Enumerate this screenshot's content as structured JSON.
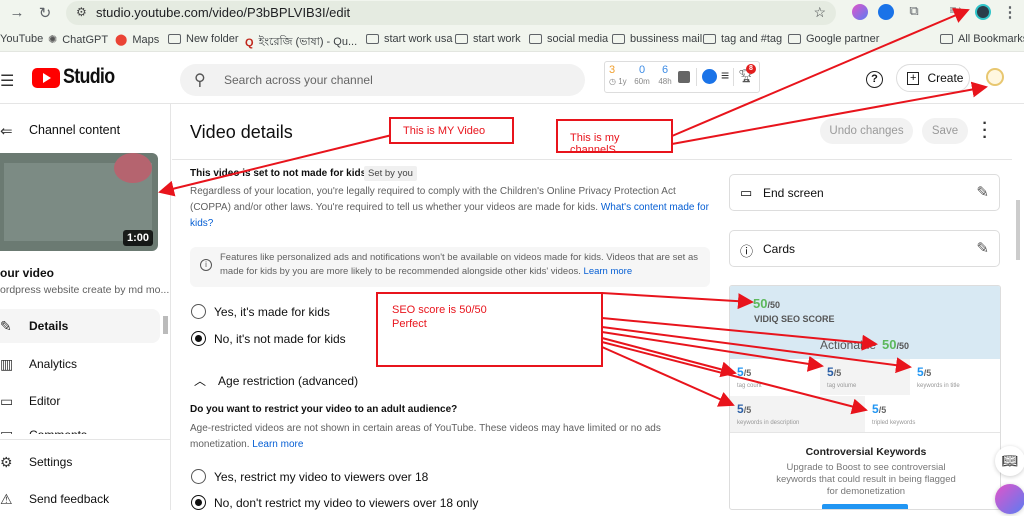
{
  "browser": {
    "url": "studio.youtube.com/video/P3bBPLVIB3I/edit",
    "bookmarks": [
      {
        "label": "YouTube",
        "icon": "youtube"
      },
      {
        "label": "ChatGPT",
        "icon": "chatgpt-icon"
      },
      {
        "label": "Maps",
        "icon": "maps-pin-icon"
      },
      {
        "label": "New folder",
        "icon": "folder-icon"
      },
      {
        "label": "ইংরেজি (ভাষা) - Qu...",
        "icon": "quora-icon"
      },
      {
        "label": "start work usa",
        "icon": "folder-icon"
      },
      {
        "label": "start work",
        "icon": "folder-icon"
      },
      {
        "label": "social media",
        "icon": "folder-icon"
      },
      {
        "label": "bussiness mail",
        "icon": "folder-icon"
      },
      {
        "label": "tag and #tag",
        "icon": "folder-icon"
      },
      {
        "label": "Google partner",
        "icon": "folder-icon"
      }
    ],
    "all_bookmarks": "All Bookmarks"
  },
  "header": {
    "logo_text": "Studio",
    "search_placeholder": "Search across your channel",
    "vidiq_stats": [
      {
        "value": "3",
        "label": "1y",
        "color": "#f0a030"
      },
      {
        "value": "0",
        "label": "60m",
        "color": "#3d8ce6"
      },
      {
        "value": "6",
        "label": "48h",
        "color": "#3d8ce6"
      }
    ],
    "notification_count": "8",
    "create_label": "Create"
  },
  "sidebar": {
    "title": "Channel content",
    "video_duration": "1:00",
    "video_title": "our video",
    "video_desc": "ordpress website create by md mo...",
    "items": [
      {
        "label": "Details",
        "icon": "pencil-icon",
        "active": true
      },
      {
        "label": "Analytics",
        "icon": "analytics-icon"
      },
      {
        "label": "Editor",
        "icon": "editor-icon"
      },
      {
        "label": "Comments",
        "icon": "comments-icon"
      }
    ],
    "bottom": [
      {
        "label": "Settings",
        "icon": "gear-icon"
      },
      {
        "label": "Send feedback",
        "icon": "feedback-icon"
      }
    ]
  },
  "main": {
    "title": "Video details",
    "undo_label": "Undo changes",
    "save_label": "Save",
    "kids_status": "This video is set to not made for kids",
    "set_by": "Set by you",
    "coppa_text": "Regardless of your location, you're legally required to comply with the Children's Online Privacy Protection Act (COPPA) and/or other laws. You're required to tell us whether your videos are made for kids.",
    "coppa_link": "What's content made for kids?",
    "info_text": "Features like personalized ads and notifications won't be available on videos made for kids. Videos that are set as made for kids by you are more likely to be recommended alongside other kids' videos.",
    "info_link": "Learn more",
    "kids_options": [
      {
        "label": "Yes, it's made for kids",
        "selected": false
      },
      {
        "label": "No, it's not made for kids",
        "selected": true
      }
    ],
    "age_header": "Age restriction (advanced)",
    "age_question": "Do you want to restrict your video to an adult audience?",
    "age_text": "Age-restricted videos are not shown in certain areas of YouTube. These videos may have limited or no ads monetization.",
    "age_link": "Learn more",
    "age_options": [
      {
        "label": "Yes, restrict my video to viewers over 18",
        "selected": false
      },
      {
        "label": "No, don't restrict my video to viewers over 18 only",
        "selected": true
      }
    ]
  },
  "right_panel": {
    "end_screen": "End screen",
    "cards": "Cards",
    "seo": {
      "score": "50",
      "max": "/50",
      "label": "VIDIQ SEO SCORE",
      "actionable_label": "Actionable",
      "actionable_score": "50",
      "actionable_max": "/50",
      "metrics": [
        {
          "value": "5",
          "max": "/5",
          "label": "tag count",
          "color": "#2196f3"
        },
        {
          "value": "5",
          "max": "/5",
          "label": "tag volume",
          "color": "#2b5fa6"
        },
        {
          "value": "5",
          "max": "/5",
          "label": "keywords in title",
          "color": "#2196f3"
        },
        {
          "value": "5",
          "max": "/5",
          "label": "keywords in description",
          "color": "#2b5fa6"
        },
        {
          "value": "5",
          "max": "/5",
          "label": "tripled keywords",
          "color": "#2196f3"
        }
      ],
      "controversial_title": "Controversial Keywords",
      "controversial_desc": "Upgrade to Boost to see controversial keywords that could result in being flagged for demonetization"
    }
  },
  "annotations": {
    "my_video": "This is MY Video",
    "my_channel": "This is my channelS",
    "seo_line1": "SEO score is 50/50",
    "seo_line2": "Perfect",
    "color": "#e8141c"
  }
}
